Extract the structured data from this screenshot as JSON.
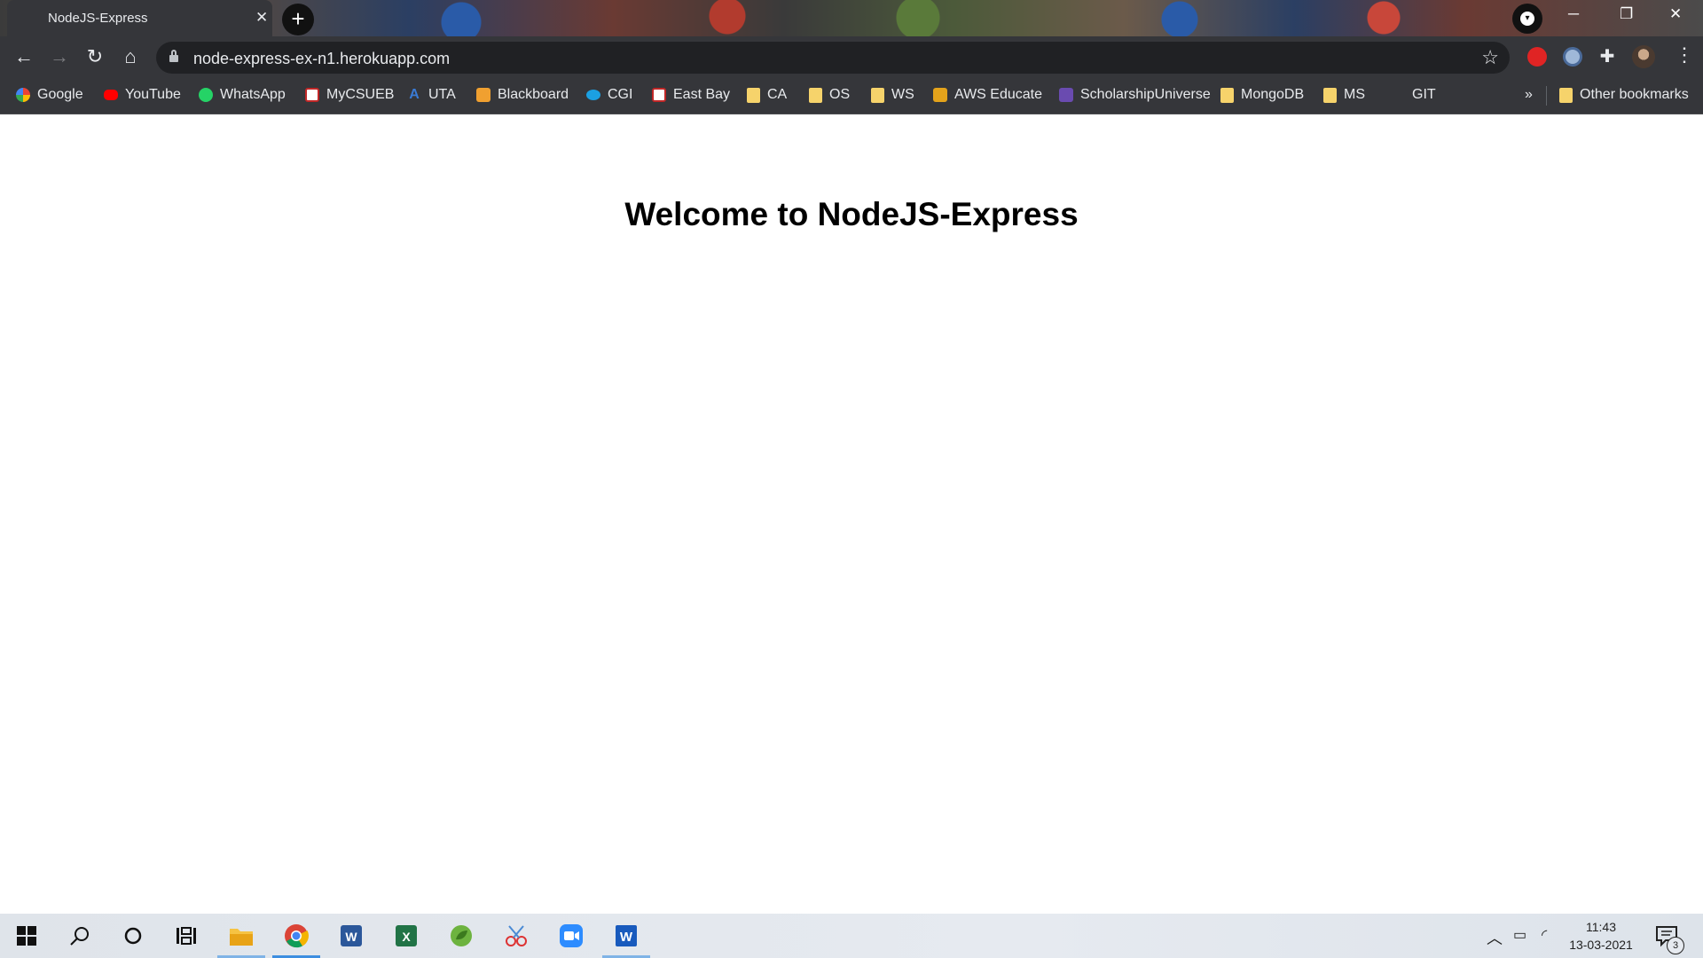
{
  "browser": {
    "tab": {
      "title": "NodeJS-Express",
      "close_glyph": "✕"
    },
    "new_tab_glyph": "+",
    "window_controls": {
      "minimize": "─",
      "restore": "❐",
      "close": "✕"
    },
    "address_bar": {
      "url": "node-express-ex-n1.herokuapp.com"
    },
    "nav": {
      "back": "←",
      "forward": "→",
      "reload": "↻",
      "home": "⌂",
      "star": "☆",
      "menu": "⋮"
    },
    "bookmarks": [
      {
        "label": "Google",
        "icon": "google-icon"
      },
      {
        "label": "YouTube",
        "icon": "youtube-icon"
      },
      {
        "label": "WhatsApp",
        "icon": "whatsapp-icon"
      },
      {
        "label": "MyCSUEB",
        "icon": "eb-icon"
      },
      {
        "label": "UTA",
        "icon": "uta-icon"
      },
      {
        "label": "Blackboard",
        "icon": "blackboard-icon"
      },
      {
        "label": "CGI",
        "icon": "cgi-icon"
      },
      {
        "label": "East Bay",
        "icon": "eb-icon"
      },
      {
        "label": "CA",
        "icon": "folder-icon"
      },
      {
        "label": "OS",
        "icon": "folder-icon"
      },
      {
        "label": "WS",
        "icon": "folder-icon"
      },
      {
        "label": "AWS Educate",
        "icon": "aws-icon"
      },
      {
        "label": "ScholarshipUniverse",
        "icon": "scholarship-icon"
      },
      {
        "label": "MongoDB",
        "icon": "folder-icon"
      },
      {
        "label": "MS",
        "icon": "folder-icon"
      },
      {
        "label": "GIT",
        "icon": ""
      }
    ],
    "overflow_glyph": "»",
    "other_bookmarks": "Other bookmarks"
  },
  "page": {
    "heading": "Welcome to NodeJS-Express"
  },
  "taskbar": {
    "apps": [
      "start",
      "search",
      "cortana",
      "task-view",
      "file-explorer",
      "chrome",
      "word-alt",
      "excel",
      "spring-tool",
      "snipping-tool",
      "zoom",
      "word"
    ],
    "clock": {
      "time": "11:43",
      "date": "13-03-2021"
    },
    "notification_count": "3",
    "colors": {
      "accent": "#3d8ee0"
    }
  }
}
